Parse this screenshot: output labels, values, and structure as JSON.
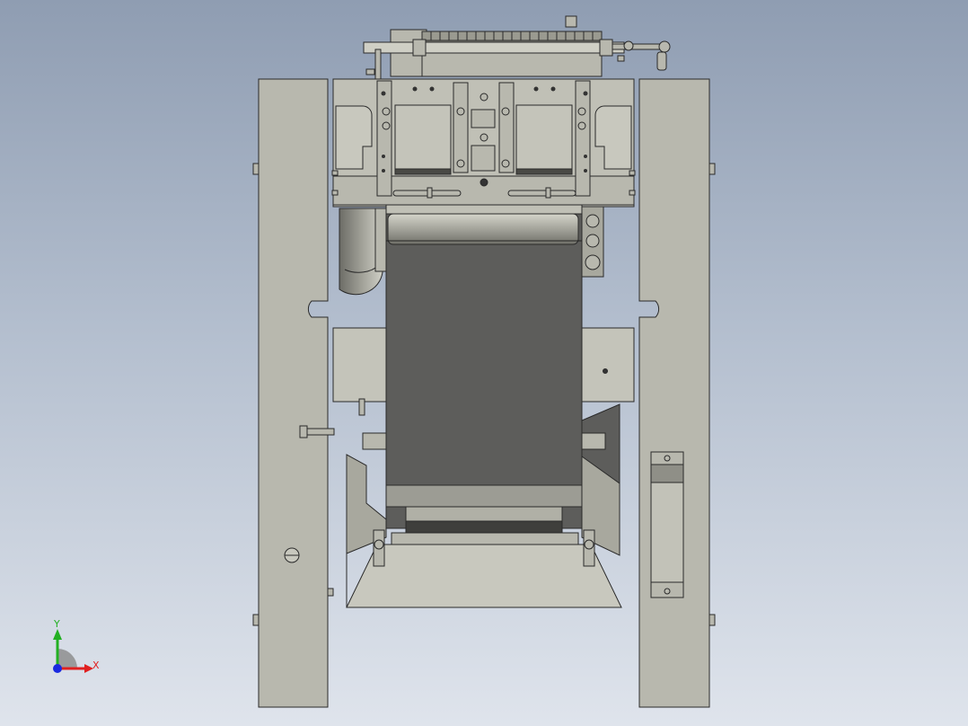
{
  "view": {
    "background_top": "#8f9db2",
    "background_bottom": "#dfe4ec",
    "part_fill": "#b8b8ae",
    "part_stroke": "#2a2a2a",
    "belt_fill": "#5d5d5b"
  },
  "triad": {
    "y_label": "Y",
    "x_label": "X",
    "y_color": "#22b022",
    "x_color": "#e02020",
    "z_color": "#1a2ae0"
  }
}
